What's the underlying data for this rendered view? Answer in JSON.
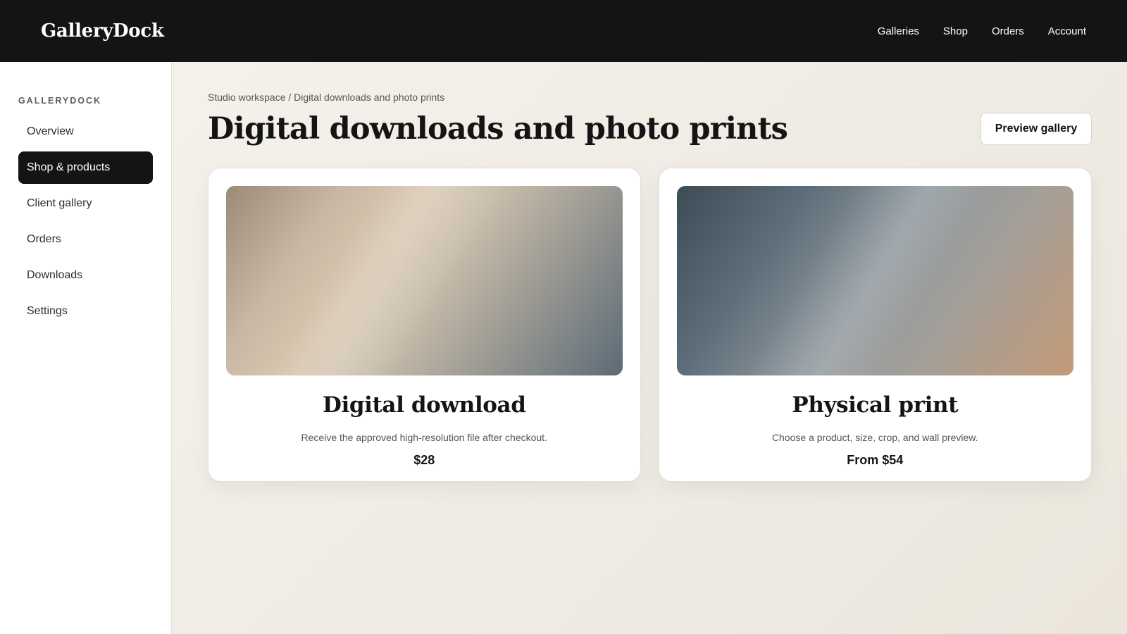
{
  "header": {
    "brand": "GalleryDock",
    "nav": [
      "Galleries",
      "Shop",
      "Orders",
      "Account"
    ]
  },
  "sidebar": {
    "heading": "GALLERYDOCK",
    "items": [
      {
        "label": "Overview",
        "active": false
      },
      {
        "label": "Shop & products",
        "active": true
      },
      {
        "label": "Client gallery",
        "active": false
      },
      {
        "label": "Orders",
        "active": false
      },
      {
        "label": "Downloads",
        "active": false
      },
      {
        "label": "Settings",
        "active": false
      }
    ]
  },
  "main": {
    "breadcrumb": "Studio workspace / Digital downloads and photo prints",
    "title": "Digital downloads and photo prints",
    "preview_button": "Preview gallery",
    "cards": [
      {
        "title": "Digital download",
        "description": "Receive the approved high-resolution file after checkout.",
        "price": "$28"
      },
      {
        "title": "Physical print",
        "description": "Choose a product, size, crop, and wall preview.",
        "price": "From $54"
      }
    ]
  },
  "colors": {
    "topbar": "#141414",
    "active_nav": "#141414",
    "page_background": "#f3f0ea"
  }
}
